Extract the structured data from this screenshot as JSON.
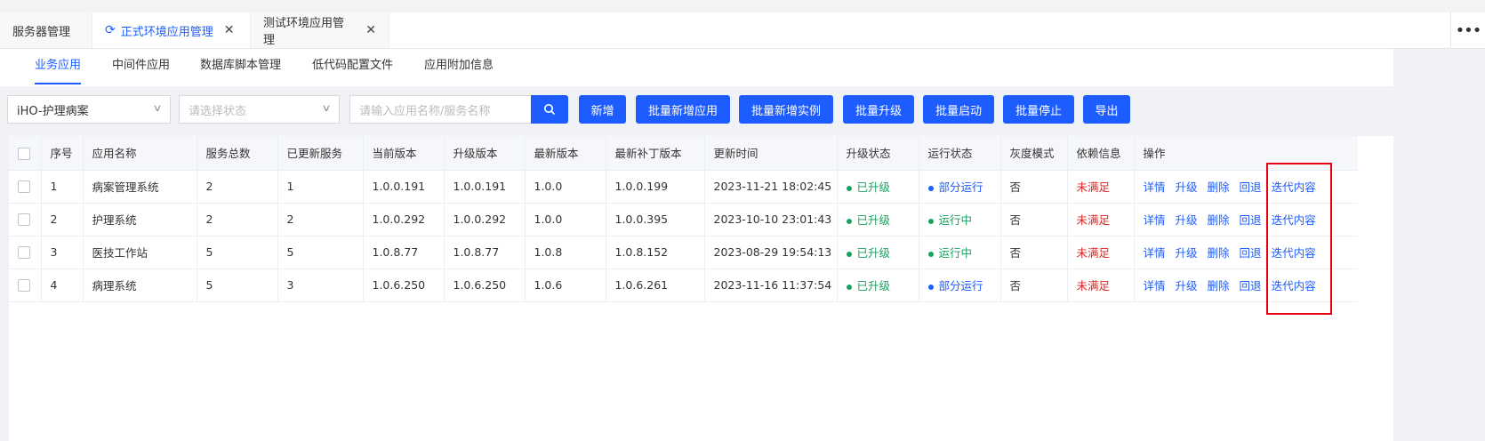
{
  "tabs": [
    {
      "label": "服务器管理",
      "active": false,
      "closable": false
    },
    {
      "label": "正式环境应用管理",
      "active": true,
      "closable": true
    },
    {
      "label": "测试环境应用管理",
      "active": false,
      "closable": true
    }
  ],
  "subnav": [
    "业务应用",
    "中间件应用",
    "数据库脚本管理",
    "低代码配置文件",
    "应用附加信息"
  ],
  "filters": {
    "org_select": "iHO-护理病案",
    "status_placeholder": "请选择状态",
    "search_placeholder": "请输入应用名称/服务名称"
  },
  "buttons": {
    "add": "新增",
    "batch_add_app": "批量新增应用",
    "batch_add_instance": "批量新增实例",
    "batch_upgrade": "批量升级",
    "batch_start": "批量启动",
    "batch_stop": "批量停止",
    "export": "导出"
  },
  "table": {
    "headers": [
      "序号",
      "应用名称",
      "服务总数",
      "已更新服务",
      "当前版本",
      "升级版本",
      "最新版本",
      "最新补丁版本",
      "更新时间",
      "升级状态",
      "运行状态",
      "灰度模式",
      "依赖信息",
      "操作"
    ],
    "ops": [
      "详情",
      "升级",
      "删除",
      "回退",
      "迭代内容"
    ],
    "rows": [
      {
        "no": "1",
        "name": "病案管理系统",
        "total": "2",
        "updated": "1",
        "current": "1.0.0.191",
        "upgrade": "1.0.0.191",
        "latest": "1.0.0",
        "patch": "1.0.0.199",
        "time": "2023-11-21 18:02:45",
        "upgrade_status": "已升级",
        "run_status": "部分运行",
        "run_color": "#1d5cff",
        "gray": "否",
        "dep": "未满足"
      },
      {
        "no": "2",
        "name": "护理系统",
        "total": "2",
        "updated": "2",
        "current": "1.0.0.292",
        "upgrade": "1.0.0.292",
        "latest": "1.0.0",
        "patch": "1.0.0.395",
        "time": "2023-10-10 23:01:43",
        "upgrade_status": "已升级",
        "run_status": "运行中",
        "run_color": "#19a15f",
        "gray": "否",
        "dep": "未满足"
      },
      {
        "no": "3",
        "name": "医技工作站",
        "total": "5",
        "updated": "5",
        "current": "1.0.8.77",
        "upgrade": "1.0.8.77",
        "latest": "1.0.8",
        "patch": "1.0.8.152",
        "time": "2023-08-29 19:54:13",
        "upgrade_status": "已升级",
        "run_status": "运行中",
        "run_color": "#19a15f",
        "gray": "否",
        "dep": "未满足"
      },
      {
        "no": "4",
        "name": "病理系统",
        "total": "5",
        "updated": "3",
        "current": "1.0.6.250",
        "upgrade": "1.0.6.250",
        "latest": "1.0.6",
        "patch": "1.0.6.261",
        "time": "2023-11-16 11:37:54",
        "upgrade_status": "已升级",
        "run_status": "部分运行",
        "run_color": "#1d5cff",
        "gray": "否",
        "dep": "未满足"
      }
    ]
  },
  "colors": {
    "accent": "#1d5cff",
    "success": "#19a15f",
    "danger": "#e02020",
    "highlight_box": "#e60012"
  }
}
